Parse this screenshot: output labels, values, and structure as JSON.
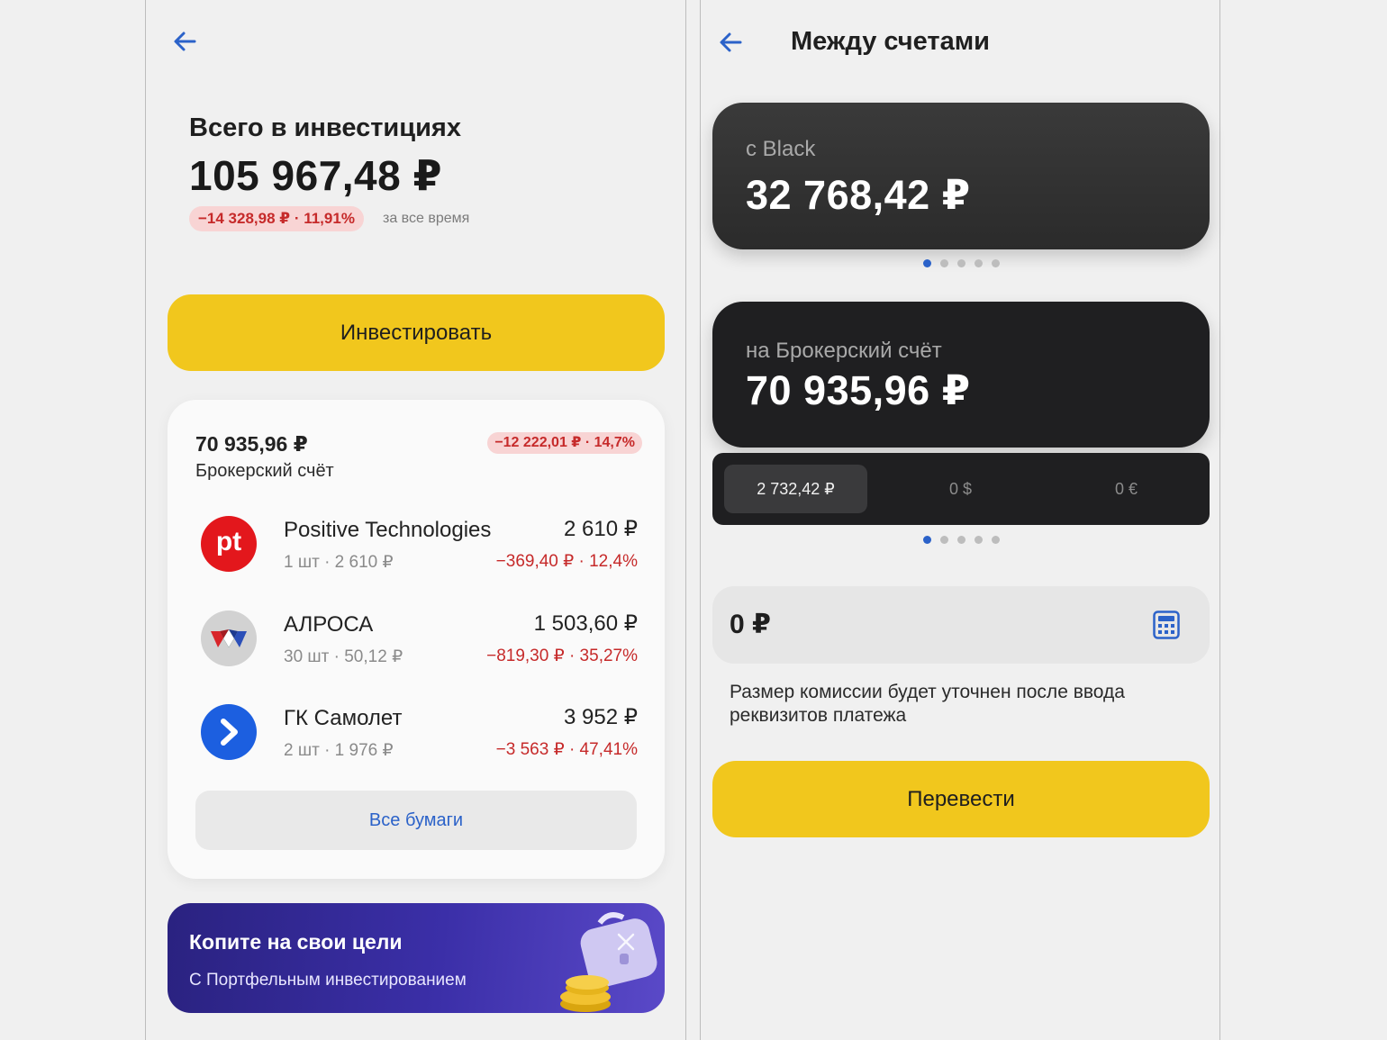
{
  "left": {
    "total_label": "Всего в инвестициях",
    "total_amount": "105 967,48 ₽",
    "total_change": "−14 328,98 ₽ · 11,91%",
    "total_period": "за все время",
    "invest_button": "Инвестировать",
    "broker": {
      "amount": "70 935,96 ₽",
      "label": "Брокерский счёт",
      "change": "−12 222,01 ₽ · 14,7%"
    },
    "stocks": [
      {
        "name": "Positive Technologies",
        "qty": "1 шт · 2 610 ₽",
        "value": "2 610 ₽",
        "change": "−369,40 ₽ · 12,4%",
        "logo_text": "pt",
        "logo_color": "#e3171c"
      },
      {
        "name": "АЛРОСА",
        "qty": "30 шт · 50,12 ₽",
        "value": "1 503,60 ₽",
        "change": "−819,30 ₽ · 35,27%",
        "logo_color": "#d2d2d2"
      },
      {
        "name": "ГК Самолет",
        "qty": "2 шт · 1 976 ₽",
        "value": "3 952 ₽",
        "change": "−3 563 ₽ · 47,41%",
        "logo_color": "#1c5fe0"
      }
    ],
    "all_papers_button": "Все бумаги",
    "promo": {
      "title": "Копите на свои цели",
      "subtitle": "С Портфельным инвестированием"
    }
  },
  "right": {
    "title": "Между счетами",
    "from_card": {
      "label": "с Black",
      "amount": "32 768,42 ₽"
    },
    "to_card": {
      "label": "на Брокерский счёт",
      "amount": "70 935,96 ₽"
    },
    "currency_tabs": [
      "2 732,42 ₽",
      "0 $",
      "0 €"
    ],
    "amount_value": "0 ₽",
    "commission_note": "Размер комиссии будет уточнен после ввода реквизитов платежа",
    "transfer_button": "Перевести"
  },
  "colors": {
    "accent_yellow": "#f1c71d",
    "link_blue": "#2b62c9",
    "negative_red": "#c62a2a",
    "card_dark": "#1f1f21"
  }
}
